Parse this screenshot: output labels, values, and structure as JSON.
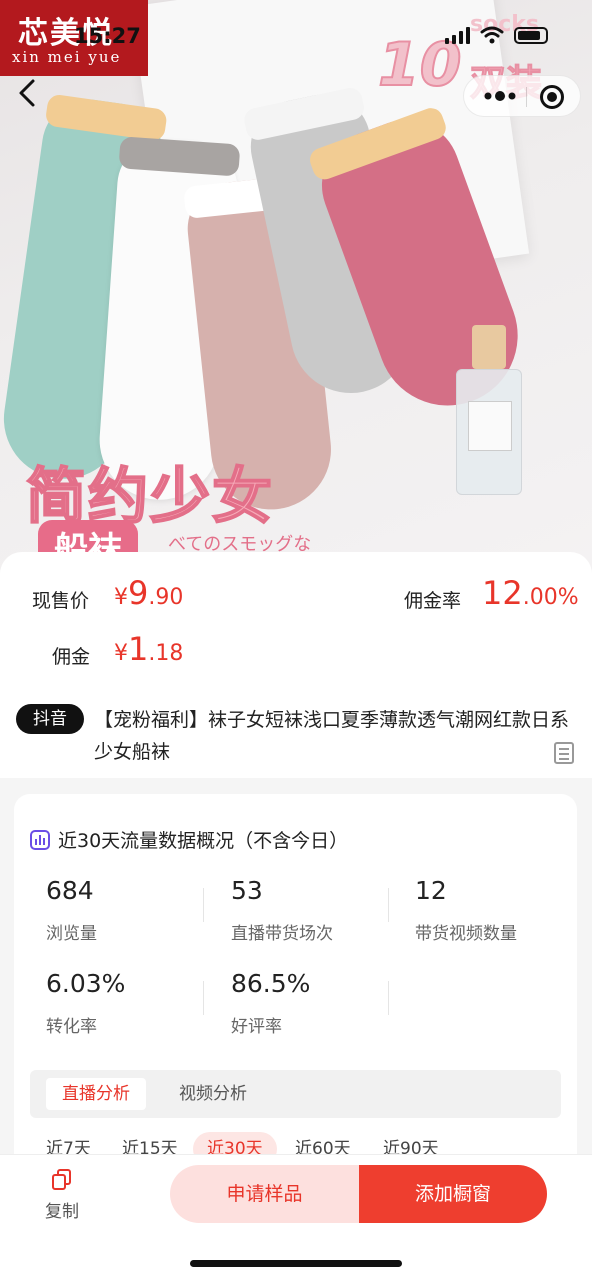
{
  "brand": {
    "name_cn": "芯美悦",
    "name_en": "xin mei yue"
  },
  "status_bar": {
    "time": "15:27"
  },
  "hero": {
    "promo_main": "简约少女",
    "promo_tag": "船袜",
    "promo_jp": "べてのスモッグな",
    "promo_count": "10",
    "promo_pairs": "双装",
    "promo_socks": "socks"
  },
  "price": {
    "current_label": "现售价",
    "currency": "¥",
    "current_int": "9",
    "current_dec": ".90",
    "rate_label": "佣金率",
    "rate_int": "12",
    "rate_dec": ".00%",
    "commission_label": "佣金",
    "commission_int": "1",
    "commission_dec": ".18"
  },
  "product": {
    "platform": "抖音",
    "title": "【宠粉福利】袜子女短袜浅口夏季薄款透气潮网红款日系少女船袜"
  },
  "traffic": {
    "title": "近30天流量数据概况（不含今日）",
    "stats": [
      {
        "value": "684",
        "label": "浏览量"
      },
      {
        "value": "53",
        "label": "直播带货场次"
      },
      {
        "value": "12",
        "label": "带货视频数量"
      },
      {
        "value": "6.03%",
        "label": "转化率"
      },
      {
        "value": "86.5%",
        "label": "好评率"
      }
    ],
    "tabs": [
      "直播分析",
      "视频分析"
    ],
    "ranges": [
      "近7天",
      "近15天",
      "近30天",
      "近60天",
      "近90天"
    ],
    "active_range": "近30天"
  },
  "bottom": {
    "copy_label": "复制",
    "sample_label": "申请样品",
    "window_label": "添加橱窗"
  },
  "colors": {
    "accent": "#e8352a",
    "brand_red": "#b3191e",
    "sample_bg": "#fde0de"
  }
}
